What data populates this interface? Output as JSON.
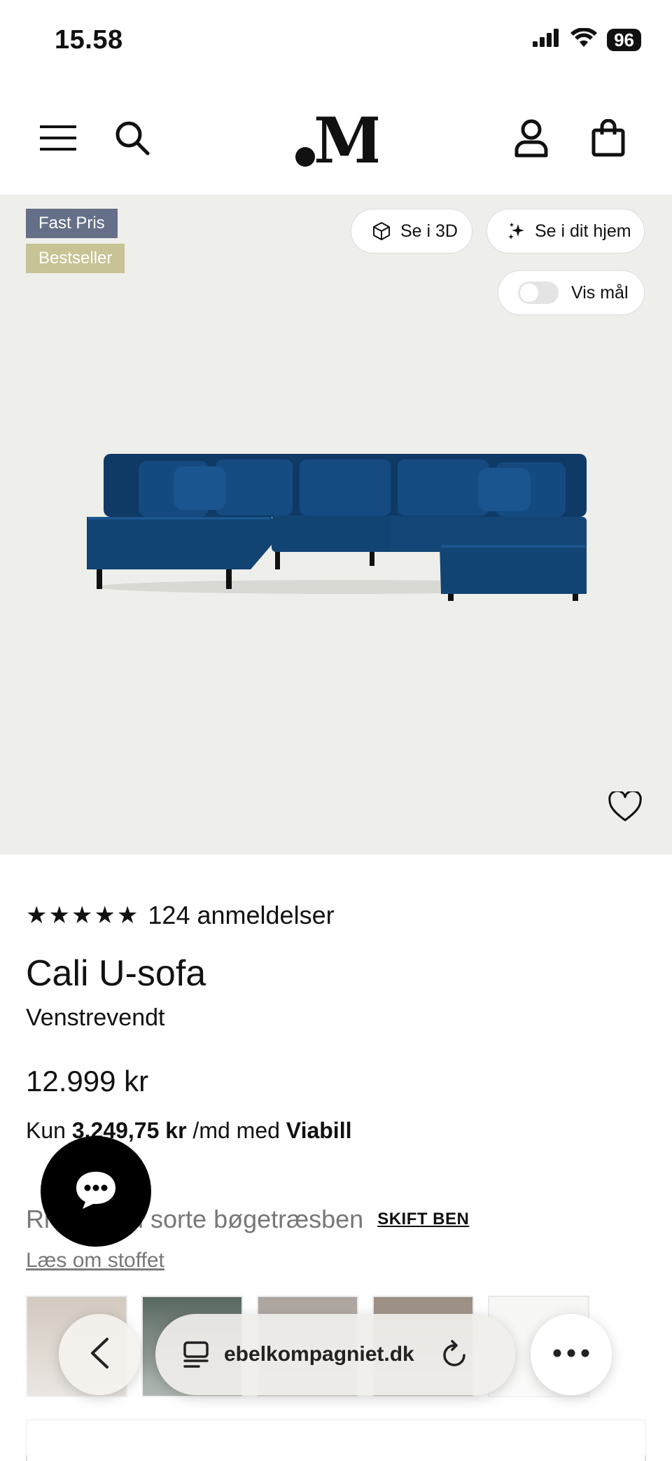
{
  "status": {
    "time": "15.58",
    "battery": "96"
  },
  "header": {
    "icons": [
      "menu-icon",
      "search-icon",
      "account-icon",
      "cart-icon"
    ],
    "logo": "M"
  },
  "hero": {
    "badges": [
      "Fast Pris",
      "Bestseller"
    ],
    "view_3d": "Se i 3D",
    "view_home": "Se i dit hjem",
    "show_dims": "Vis mål",
    "image_alt": "blue velvet U-sofa"
  },
  "product": {
    "stars": "★★★★★",
    "reviews": "124 anmeldelser",
    "name": "Cali U-sofa",
    "variant": "Venstrevendt",
    "price": "12.999 kr",
    "financing": {
      "prefix": "Kun",
      "amount": "3.249,75 kr",
      "middle": "/md med",
      "provider": "Viabill"
    },
    "fabric_line": "Riv… med sorte bøgetræsben",
    "change_legs": "SKIFT BEN",
    "read_fabric": "Læs om stoffet",
    "swatch_colors": [
      "#c9beb2",
      "#36493e",
      "#9a9088",
      "#857568",
      "#f4f4f2"
    ]
  },
  "browser": {
    "url": "ebelkompagniet.dk"
  },
  "colors": {
    "hero_bg": "#eeeeeb",
    "sofa": "#123f6e",
    "badge_fast": "#657088",
    "badge_best": "#c7c394"
  }
}
